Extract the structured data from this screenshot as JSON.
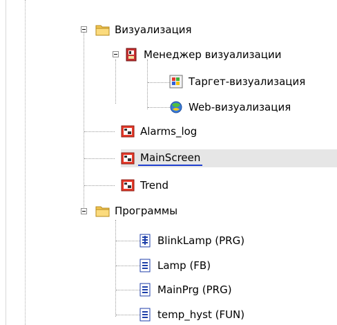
{
  "tree": {
    "visualization_folder": {
      "label": "Визуализация",
      "icon": "folder-icon"
    },
    "visu_manager": {
      "label": "Менеджер визуализации",
      "icon": "visualization-manager-icon"
    },
    "target_visu": {
      "label": "Таргет-визуализация",
      "icon": "target-visualization-icon"
    },
    "web_visu": {
      "label": "Web-визуализация",
      "icon": "web-visualization-icon"
    },
    "alarms_log": {
      "label": "Alarms_log",
      "icon": "visualization-screen-icon"
    },
    "main_screen": {
      "label": "MainScreen",
      "icon": "visualization-screen-icon",
      "selected": true
    },
    "trend": {
      "label": "Trend",
      "icon": "visualization-screen-icon"
    },
    "programs_folder": {
      "label": "Программы",
      "icon": "folder-icon"
    },
    "blink_lamp": {
      "label": "BlinkLamp (PRG)",
      "icon": "program-icon"
    },
    "lamp": {
      "label": "Lamp (FB)",
      "icon": "function-block-icon"
    },
    "main_prg": {
      "label": "MainPrg (PRG)",
      "icon": "program-icon"
    },
    "temp_hyst": {
      "label": "temp_hyst (FUN)",
      "icon": "function-icon"
    }
  },
  "colors": {
    "selection_underline": "#1f3fd0",
    "selection_background": "#e6e6e6",
    "folder": "#f2c552"
  }
}
